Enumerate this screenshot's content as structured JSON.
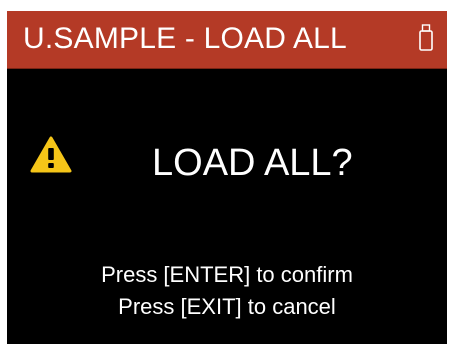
{
  "header": {
    "title": "U.SAMPLE - LOAD ALL",
    "status_icon": "usb-drive-icon",
    "background_color": "#b43a26"
  },
  "dialog": {
    "icon": "warning-icon",
    "icon_color": "#f5c518",
    "question": "LOAD ALL?",
    "confirm_instruction": "Press [ENTER] to confirm",
    "cancel_instruction": "Press [EXIT] to cancel"
  }
}
